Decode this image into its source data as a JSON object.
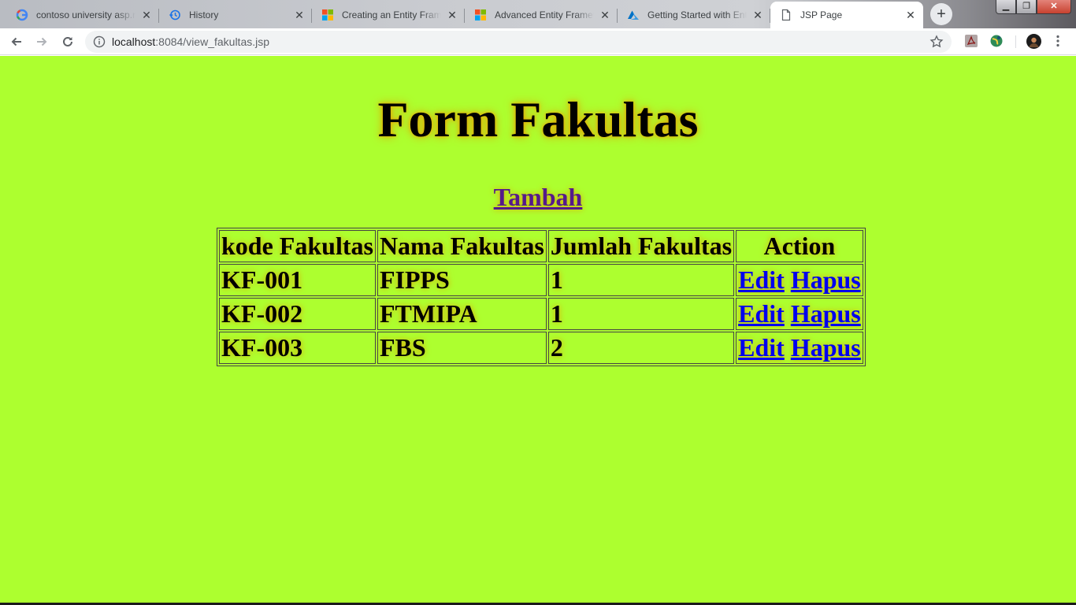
{
  "tabs": [
    {
      "title": "contoso university asp.net",
      "icon": "google-icon"
    },
    {
      "title": "History",
      "icon": "history-icon"
    },
    {
      "title": "Creating an Entity Framework",
      "icon": "microsoft-icon"
    },
    {
      "title": "Advanced Entity Framework",
      "icon": "microsoft-icon"
    },
    {
      "title": "Getting Started with Entity",
      "icon": "azure-icon"
    },
    {
      "title": "JSP Page",
      "icon": "page-icon"
    }
  ],
  "active_tab": 5,
  "address_bar": {
    "host": "localhost",
    "path": ":8084/view_fakultas.jsp"
  },
  "page": {
    "title": "Form Fakultas",
    "add_link": "Tambah",
    "background": "#adff2f",
    "table": {
      "headers": [
        "kode Fakultas",
        "Nama Fakultas",
        "Jumlah Fakultas",
        "Action"
      ],
      "rows": [
        {
          "kode": "KF-001",
          "nama": "FIPPS",
          "jumlah": "1",
          "edit": "Edit",
          "hapus": "Hapus"
        },
        {
          "kode": "KF-002",
          "nama": "FTMIPA",
          "jumlah": "1",
          "edit": "Edit",
          "hapus": "Hapus"
        },
        {
          "kode": "KF-003",
          "nama": "FBS",
          "jumlah": "2",
          "edit": "Edit",
          "hapus": "Hapus"
        }
      ]
    }
  }
}
